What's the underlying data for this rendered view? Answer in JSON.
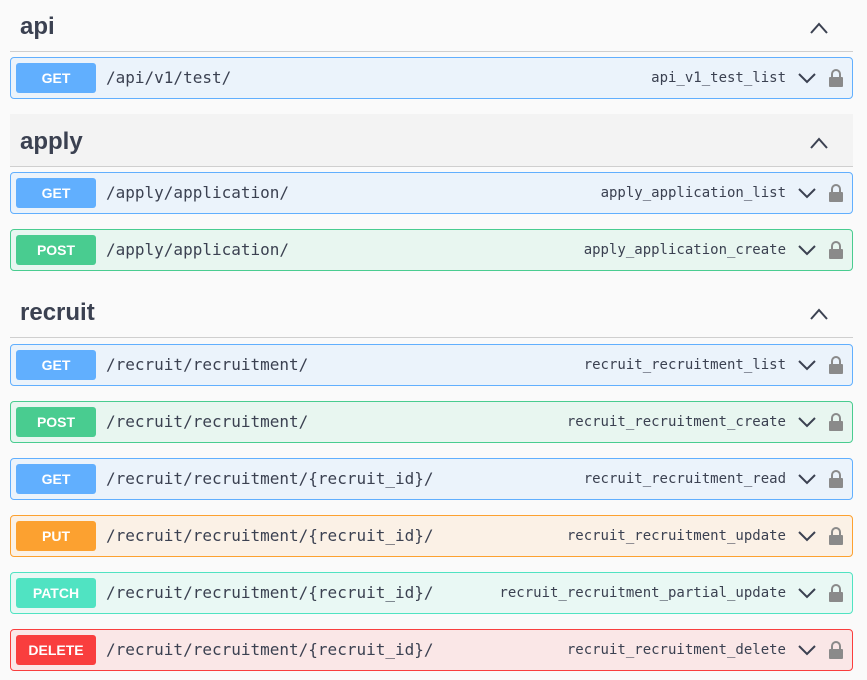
{
  "sections": [
    {
      "title": "api",
      "operations": [
        {
          "method": "GET",
          "path": "/api/v1/test/",
          "operation_id": "api_v1_test_list"
        }
      ]
    },
    {
      "title": "apply",
      "operations": [
        {
          "method": "GET",
          "path": "/apply/application/",
          "operation_id": "apply_application_list"
        },
        {
          "method": "POST",
          "path": "/apply/application/",
          "operation_id": "apply_application_create"
        }
      ]
    },
    {
      "title": "recruit",
      "operations": [
        {
          "method": "GET",
          "path": "/recruit/recruitment/",
          "operation_id": "recruit_recruitment_list"
        },
        {
          "method": "POST",
          "path": "/recruit/recruitment/",
          "operation_id": "recruit_recruitment_create"
        },
        {
          "method": "GET",
          "path": "/recruit/recruitment/{recruit_id}/",
          "operation_id": "recruit_recruitment_read"
        },
        {
          "method": "PUT",
          "path": "/recruit/recruitment/{recruit_id}/",
          "operation_id": "recruit_recruitment_update"
        },
        {
          "method": "PATCH",
          "path": "/recruit/recruitment/{recruit_id}/",
          "operation_id": "recruit_recruitment_partial_update"
        },
        {
          "method": "DELETE",
          "path": "/recruit/recruitment/{recruit_id}/",
          "operation_id": "recruit_recruitment_delete"
        }
      ]
    }
  ],
  "colors": {
    "GET": "#61affe",
    "POST": "#49cc90",
    "PUT": "#fca130",
    "PATCH": "#50e3c2",
    "DELETE": "#f93e3e",
    "text": "#3b4151"
  },
  "icons": {
    "section_toggle": "chevron-up-icon",
    "operation_toggle": "chevron-down-icon",
    "authorization": "lock-icon"
  }
}
